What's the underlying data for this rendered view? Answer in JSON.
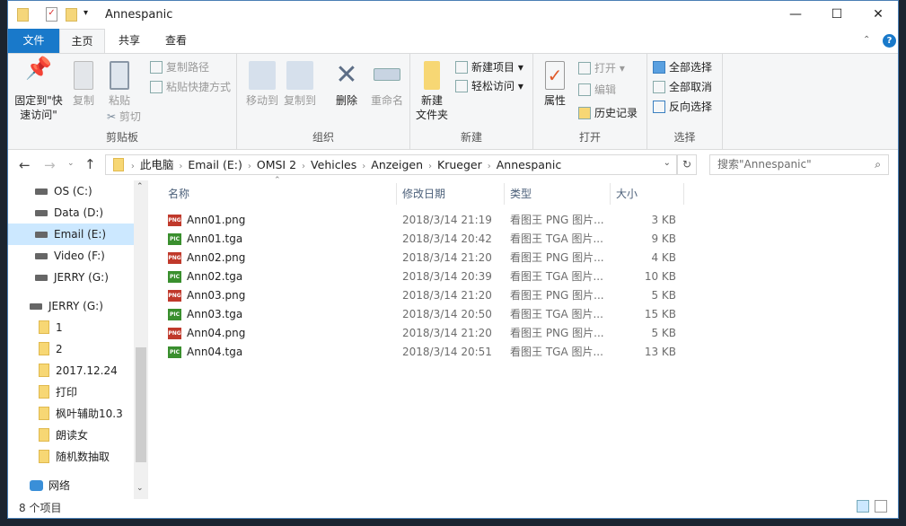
{
  "title": "Annespanic",
  "tabs": {
    "file": "文件",
    "home": "主页",
    "share": "共享",
    "view": "查看"
  },
  "ribbon": {
    "clipboard": {
      "pin": "固定到\"快速访问\"",
      "copy": "复制",
      "paste": "粘贴",
      "copy_path": "复制路径",
      "paste_shortcut": "粘贴快捷方式",
      "cut": "剪切",
      "label": "剪贴板"
    },
    "organize": {
      "move_to": "移动到",
      "copy_to": "复制到",
      "delete": "删除",
      "rename": "重命名",
      "label": "组织"
    },
    "new": {
      "new_folder": "新建\n文件夹",
      "new_item": "新建项目 ▾",
      "easy_access": "轻松访问 ▾",
      "label": "新建"
    },
    "open": {
      "properties": "属性",
      "open": "打开 ▾",
      "edit": "编辑",
      "history": "历史记录",
      "label": "打开"
    },
    "select": {
      "select_all": "全部选择",
      "select_none": "全部取消",
      "invert": "反向选择",
      "label": "选择"
    }
  },
  "breadcrumb": [
    "此电脑",
    "Email (E:)",
    "OMSI 2",
    "Vehicles",
    "Anzeigen",
    "Krueger",
    "Annespanic"
  ],
  "search_placeholder": "搜索\"Annespanic\"",
  "nav": {
    "drives": [
      "OS (C:)",
      "Data (D:)",
      "Email (E:)",
      "Video (F:)",
      "JERRY (G:)"
    ],
    "jerry": "JERRY (G:)",
    "folders": [
      "1",
      "2",
      "2017.12.24",
      "打印",
      "枫叶辅助10.3",
      "朗读女",
      "随机数抽取"
    ],
    "network": "网络"
  },
  "columns": {
    "name": "名称",
    "date": "修改日期",
    "type": "类型",
    "size": "大小"
  },
  "files": [
    {
      "name": "Ann01.png",
      "date": "2018/3/14 21:19",
      "type": "看图王 PNG 图片...",
      "size": "3 KB",
      "kind": "PNG"
    },
    {
      "name": "Ann01.tga",
      "date": "2018/3/14 20:42",
      "type": "看图王 TGA 图片...",
      "size": "9 KB",
      "kind": "PIC"
    },
    {
      "name": "Ann02.png",
      "date": "2018/3/14 21:20",
      "type": "看图王 PNG 图片...",
      "size": "4 KB",
      "kind": "PNG"
    },
    {
      "name": "Ann02.tga",
      "date": "2018/3/14 20:39",
      "type": "看图王 TGA 图片...",
      "size": "10 KB",
      "kind": "PIC"
    },
    {
      "name": "Ann03.png",
      "date": "2018/3/14 21:20",
      "type": "看图王 PNG 图片...",
      "size": "5 KB",
      "kind": "PNG"
    },
    {
      "name": "Ann03.tga",
      "date": "2018/3/14 20:50",
      "type": "看图王 TGA 图片...",
      "size": "15 KB",
      "kind": "PIC"
    },
    {
      "name": "Ann04.png",
      "date": "2018/3/14 21:20",
      "type": "看图王 PNG 图片...",
      "size": "5 KB",
      "kind": "PNG"
    },
    {
      "name": "Ann04.tga",
      "date": "2018/3/14 20:51",
      "type": "看图王 TGA 图片...",
      "size": "13 KB",
      "kind": "PIC"
    }
  ],
  "status": "8 个项目",
  "colors": {
    "accent": "#1979ca",
    "selected": "#cce8ff",
    "png": "#c0392b",
    "tga": "#3a8f2e"
  }
}
